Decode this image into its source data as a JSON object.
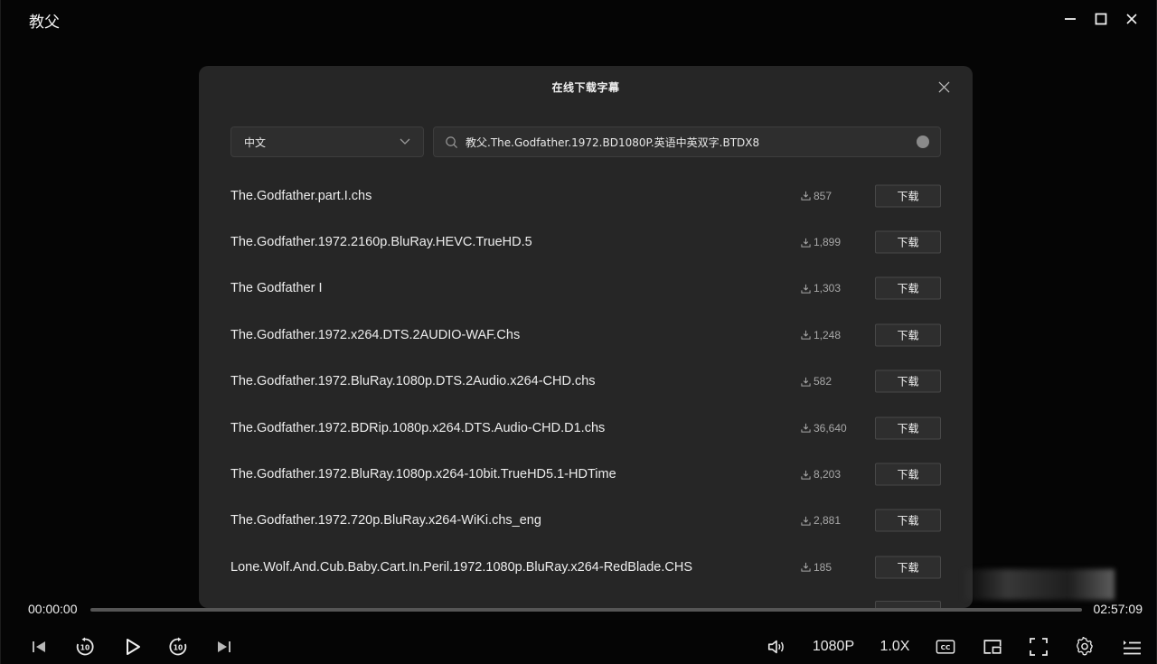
{
  "window": {
    "title": "教父"
  },
  "dialog": {
    "title": "在线下载字幕",
    "language": "中文",
    "search_value": "教父.The.Godfather.1972.BD1080P.英语中英双字.BTDX8",
    "download_label": "下载",
    "results": [
      {
        "name": "The.Godfather.part.I.chs",
        "downloads": "857"
      },
      {
        "name": "The.Godfather.1972.2160p.BluRay.HEVC.TrueHD.5",
        "downloads": "1,899"
      },
      {
        "name": "The Godfather I",
        "downloads": "1,303"
      },
      {
        "name": "The.Godfather.1972.x264.DTS.2AUDIO-WAF.Chs",
        "downloads": "1,248"
      },
      {
        "name": "The.Godfather.1972.BluRay.1080p.DTS.2Audio.x264-CHD.chs",
        "downloads": "582"
      },
      {
        "name": "The.Godfather.1972.BDRip.1080p.x264.DTS.Audio-CHD.D1.chs",
        "downloads": "36,640"
      },
      {
        "name": "The.Godfather.1972.BluRay.1080p.x264-10bit.TrueHD5.1-HDTime",
        "downloads": "8,203"
      },
      {
        "name": "The.Godfather.1972.720p.BluRay.x264-WiKi.chs_eng",
        "downloads": "2,881"
      },
      {
        "name": "Lone.Wolf.And.Cub.Baby.Cart.In.Peril.1972.1080p.BluRay.x264-RedBlade.CHS",
        "downloads": "185"
      }
    ]
  },
  "player": {
    "current_time": "00:00:00",
    "total_time": "02:57:09",
    "progress": 0,
    "quality": "1080P",
    "speed": "1.0X"
  }
}
